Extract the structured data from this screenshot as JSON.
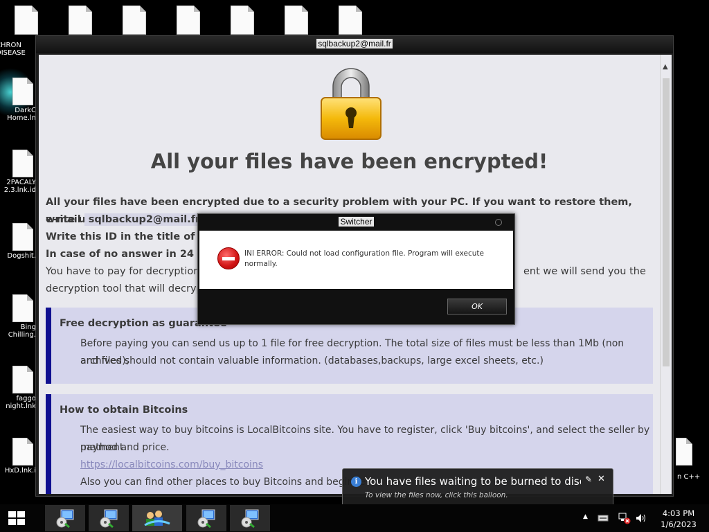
{
  "desktop": {
    "icons_left": [
      {
        "label": "CHRON\nDISEASE"
      },
      {
        "label": "DarkC\nHome.ln"
      },
      {
        "label": "2PACALY\n2.3.lnk.id"
      },
      {
        "label": "Dogshit."
      },
      {
        "label": "Bing\nChilling."
      },
      {
        "label": "faggo\nnight.lnk"
      },
      {
        "label": "HxD.lnk.i"
      }
    ],
    "right_partial_label": "n C++"
  },
  "window": {
    "title": "sqlbackup2@mail.fr",
    "headline": "All your files have been encrypted!",
    "intro_bold": "All your files have been encrypted due to a security problem with your PC. If you want to restore them, write us to the",
    "email_prefix": "e-mail",
    "email": "sqlbackup2@mail.fr",
    "id_line": "Write this ID in the title of yo",
    "no_answer_line": "In case of no answer in 24 ho",
    "pay_line_start": "You have to pay for decryption in",
    "pay_line_end": "ent we will send you the",
    "pay_line2": "decryption tool that will decrypt all",
    "free_box": {
      "title": "Free decryption as guarantee",
      "line1": "Before paying you can send us up to 1 file for free decryption. The total size of files must be less than 1Mb (non archived),",
      "line2": "and files should not contain valuable information. (databases,backups, large excel sheets, etc.)"
    },
    "bitcoin_box": {
      "title": "How to obtain Bitcoins",
      "line1": "The easiest way to buy bitcoins is LocalBitcoins site. You have to register, click 'Buy bitcoins', and select the seller by payment",
      "line2": "method and price.",
      "link": "https://localbitcoins.com/buy_bitcoins",
      "line3": "Also you can find other places to buy Bitcoins and beginne"
    }
  },
  "dialog": {
    "title": "Switcher",
    "message": "INI ERROR: Could not load configuration file. Program will execute normally.",
    "ok_label": "OK"
  },
  "balloon": {
    "title": "You have files waiting to be burned to disc",
    "subtitle": "To view the files now, click this balloon.",
    "close_glyph": "✕"
  },
  "taskbar": {
    "time": "4:03 PM",
    "date": "1/6/2023",
    "items": [
      "setup-app-1",
      "setup-app-2",
      "network-users-app",
      "setup-app-3",
      "setup-app-4"
    ]
  }
}
